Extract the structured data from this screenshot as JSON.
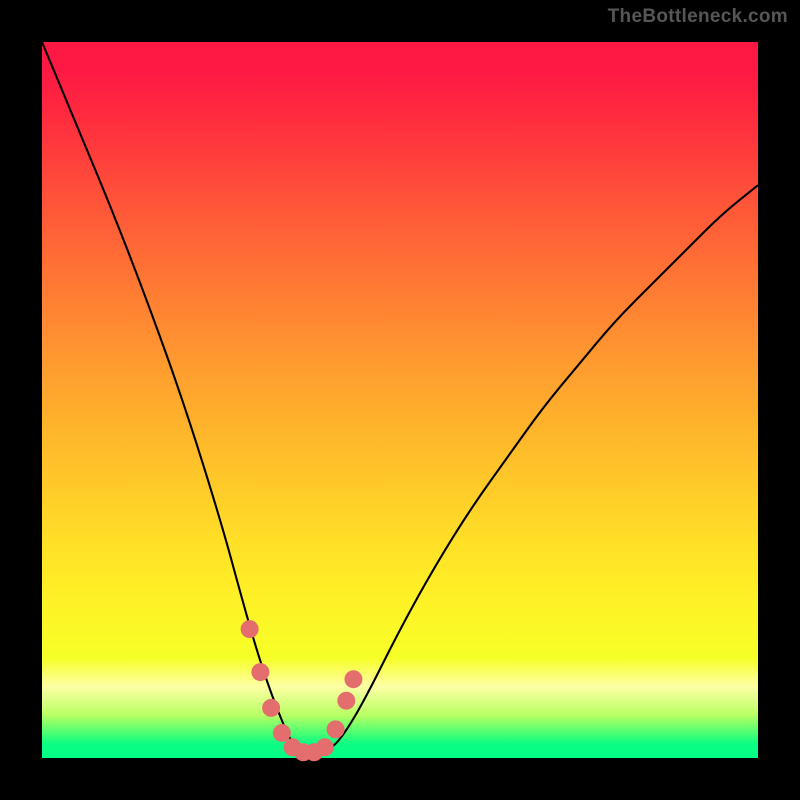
{
  "watermark": "TheBottleneck.com",
  "colors": {
    "frame": "#000000",
    "curve": "#000000",
    "markers": "#e46d6e"
  },
  "chart_data": {
    "type": "line",
    "title": "",
    "xlabel": "",
    "ylabel": "",
    "xlim": [
      0,
      100
    ],
    "ylim": [
      0,
      100
    ],
    "grid": false,
    "legend": false,
    "x": [
      0,
      5,
      10,
      15,
      20,
      25,
      28,
      30,
      32,
      34,
      35,
      36,
      37,
      38,
      39,
      40,
      42,
      45,
      50,
      55,
      60,
      65,
      70,
      75,
      80,
      85,
      90,
      95,
      100
    ],
    "values": [
      100,
      88,
      76,
      63,
      49,
      33,
      22,
      15,
      9,
      4,
      2,
      1,
      0.6,
      0.5,
      0.6,
      1,
      3,
      8,
      18,
      27,
      35,
      42,
      49,
      55,
      61,
      66,
      71,
      76,
      80
    ],
    "note": "Curve depicts bottleneck percentage vs. component balance. Minimum (~0%) near x≈37; rises steeply on both sides. Pink rounded markers overlaid near the trough region roughly x∈[29,43].",
    "marker_points": [
      {
        "x": 29.0,
        "y": 18
      },
      {
        "x": 30.5,
        "y": 12
      },
      {
        "x": 32.0,
        "y": 7
      },
      {
        "x": 33.5,
        "y": 3.5
      },
      {
        "x": 35.0,
        "y": 1.5
      },
      {
        "x": 36.5,
        "y": 0.8
      },
      {
        "x": 38.0,
        "y": 0.8
      },
      {
        "x": 39.5,
        "y": 1.5
      },
      {
        "x": 41.0,
        "y": 4
      },
      {
        "x": 42.5,
        "y": 8
      },
      {
        "x": 43.5,
        "y": 11
      }
    ]
  }
}
